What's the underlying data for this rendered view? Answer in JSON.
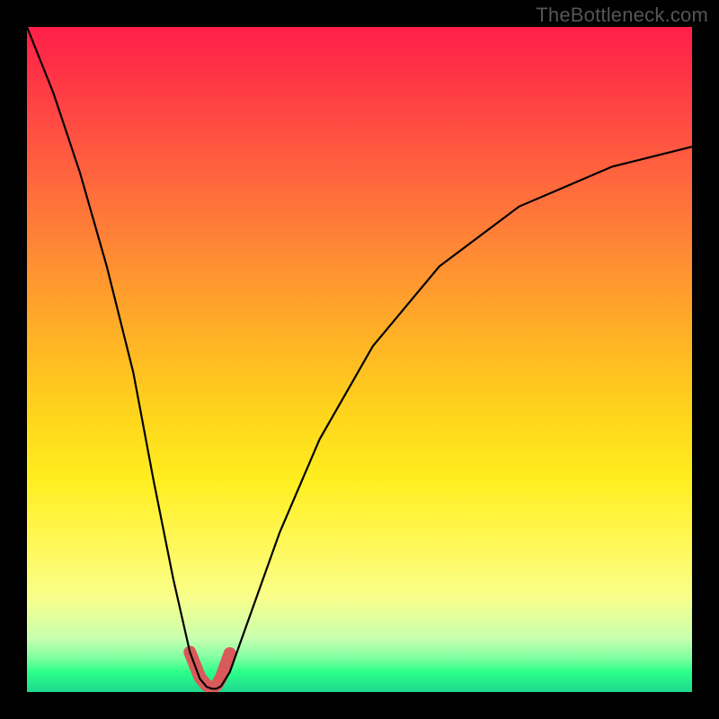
{
  "watermark": "TheBottleneck.com",
  "chart_data": {
    "type": "line",
    "title": "",
    "xlabel": "",
    "ylabel": "",
    "xlim": [
      0,
      100
    ],
    "ylim": [
      0,
      100
    ],
    "legend": false,
    "grid": false,
    "background_gradient": {
      "direction": "vertical",
      "stops": [
        {
          "pos": 0.0,
          "color": "#ff1f4a"
        },
        {
          "pos": 0.24,
          "color": "#ff6a3d"
        },
        {
          "pos": 0.46,
          "color": "#ffb026"
        },
        {
          "pos": 0.68,
          "color": "#ffee1f"
        },
        {
          "pos": 0.86,
          "color": "#f8ff8c"
        },
        {
          "pos": 0.97,
          "color": "#2cff88"
        },
        {
          "pos": 1.0,
          "color": "#1fd68d"
        }
      ]
    },
    "series": [
      {
        "name": "bottleneck-curve",
        "x": [
          0,
          4,
          8,
          12,
          16,
          19,
          22,
          24.5,
          26,
          27,
          27.8,
          28.5,
          29.2,
          30.5,
          33,
          38,
          44,
          52,
          62,
          74,
          88,
          100
        ],
        "y": [
          100,
          90,
          78,
          64,
          48,
          32,
          17,
          6,
          2,
          0.8,
          0.5,
          0.5,
          0.9,
          3,
          10,
          24,
          38,
          52,
          64,
          73,
          79,
          82
        ],
        "stroke": "#000000"
      }
    ],
    "highlight": {
      "name": "dip-marker",
      "color": "#d85a5a",
      "x": [
        24.5,
        26,
        27,
        27.8,
        28.5,
        29.2,
        30.5
      ],
      "y": [
        6,
        2.2,
        1.0,
        0.6,
        1.0,
        2.2,
        5.8
      ]
    }
  }
}
